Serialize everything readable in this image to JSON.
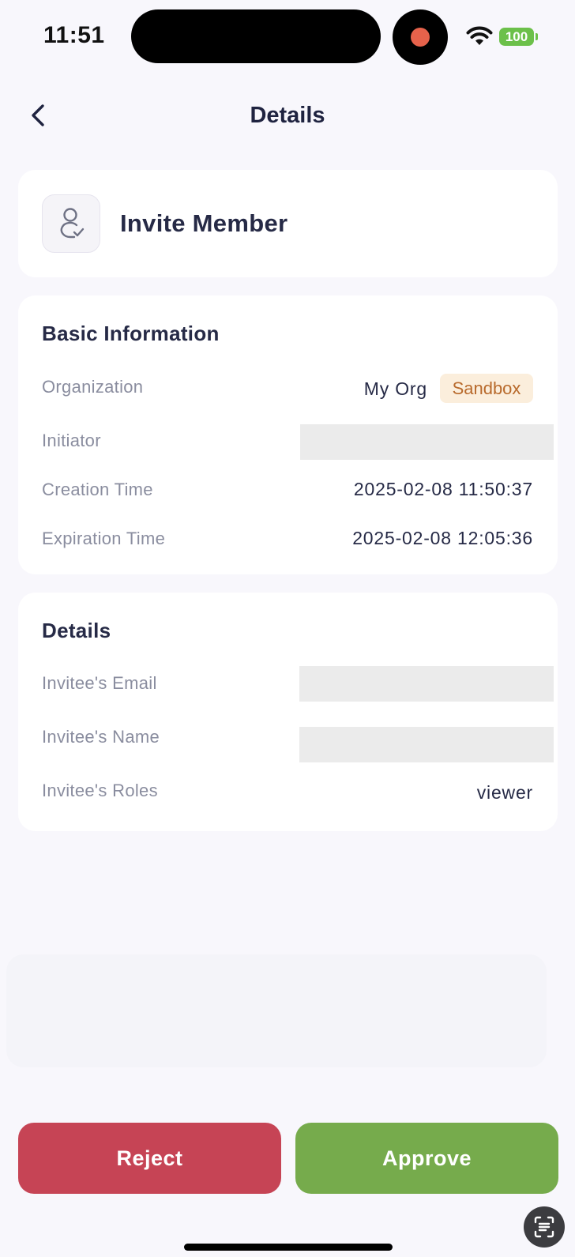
{
  "status_bar": {
    "time": "11:51",
    "battery": "100"
  },
  "nav": {
    "title": "Details"
  },
  "header": {
    "title": "Invite Member",
    "icon": "user-check-icon"
  },
  "basic_info": {
    "title": "Basic Information",
    "organization": {
      "label": "Organization",
      "value": "My Org",
      "tag": "Sandbox"
    },
    "initiator": {
      "label": "Initiator"
    },
    "creation_time": {
      "label": "Creation Time",
      "value": "2025-02-08 11:50:37"
    },
    "expiration_time": {
      "label": "Expiration Time",
      "value": "2025-02-08 12:05:36"
    }
  },
  "details": {
    "title": "Details",
    "email": {
      "label": "Invitee's Email"
    },
    "name": {
      "label": "Invitee's Name"
    },
    "roles": {
      "label": "Invitee's Roles",
      "value": "viewer"
    }
  },
  "actions": {
    "reject": "Reject",
    "approve": "Approve"
  },
  "colors": {
    "reject": "#c64455",
    "approve": "#76ab4c",
    "tag_bg": "#fbeedc",
    "tag_text": "#b86a2c"
  }
}
